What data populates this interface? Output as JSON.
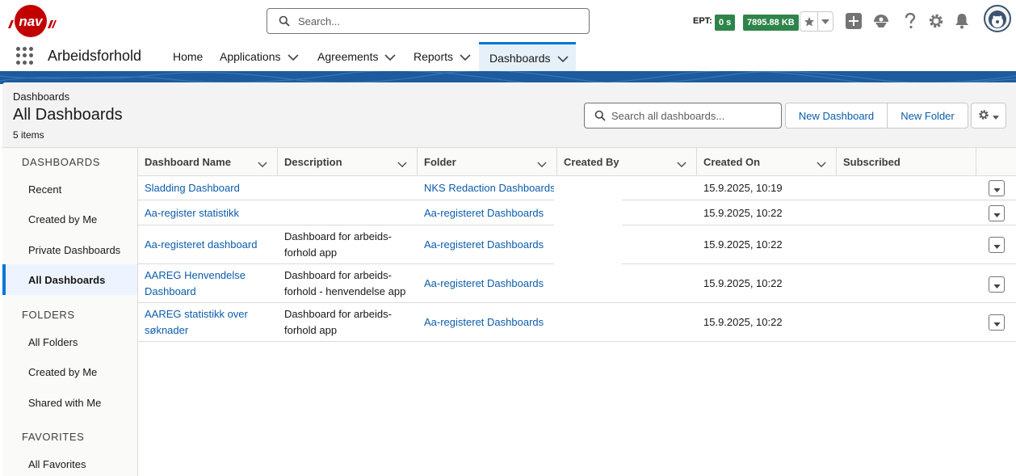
{
  "header": {
    "search_placeholder": "Search...",
    "ept_label": "EPT:",
    "ept_value": "0 s",
    "kb_value": "7895.88 KB",
    "icons": [
      "star-icon",
      "add-icon",
      "trailhead-icon",
      "help-icon",
      "gear-icon",
      "bell-icon",
      "avatar"
    ],
    "accent": "#2e844a"
  },
  "nav": {
    "app_name": "Arbeidsforhold",
    "items": [
      {
        "label": "Home",
        "has_menu": false
      },
      {
        "label": "Applications",
        "has_menu": true
      },
      {
        "label": "Agreements",
        "has_menu": true
      },
      {
        "label": "Reports",
        "has_menu": true
      },
      {
        "label": "Dashboards",
        "has_menu": true,
        "active": true
      }
    ]
  },
  "page": {
    "breadcrumb": "Dashboards",
    "title": "All Dashboards",
    "count": "5 items",
    "search_placeholder": "Search all dashboards...",
    "new_dashboard_label": "New Dashboard",
    "new_folder_label": "New Folder"
  },
  "sidebar": {
    "dashboards_heading": "DASHBOARDS",
    "dashboards_items": [
      "Recent",
      "Created by Me",
      "Private Dashboards",
      "All Dashboards"
    ],
    "active_item": "All Dashboards",
    "folders_heading": "FOLDERS",
    "folders_items": [
      "All Folders",
      "Created by Me",
      "Shared with Me"
    ],
    "favorites_heading": "FAVORITES",
    "favorites_items": [
      "All Favorites"
    ]
  },
  "table": {
    "columns": [
      "Dashboard Name",
      "Description",
      "Folder",
      "Created By",
      "Created On",
      "Subscribed"
    ],
    "rows": [
      {
        "name": "Sladding Dashboard",
        "description": "",
        "folder": "NKS Redaction Dashboards",
        "created_by": "",
        "created_on": "15.9.2025, 10:19",
        "subscribed": ""
      },
      {
        "name": "Aa-register statistikk",
        "description": "",
        "folder": "Aa-registeret Dashboards",
        "created_by": "",
        "created_on": "15.9.2025, 10:22",
        "subscribed": ""
      },
      {
        "name": "Aa-registeret dashboard",
        "description": "Dashboard for arbeids-forhold app",
        "folder": "Aa-registeret Dashboards",
        "created_by": "",
        "created_on": "15.9.2025, 10:22",
        "subscribed": ""
      },
      {
        "name": "AAREG Henvendelse Dashboard",
        "description": "Dashboard for arbeids-forhold - henvendelse app",
        "folder": "Aa-registeret Dashboards",
        "created_by": "",
        "created_on": "15.9.2025, 10:22",
        "subscribed": ""
      },
      {
        "name": "AAREG statistikk over søknader",
        "description": "Dashboard for arbeids-forhold app",
        "folder": "Aa-registeret Dashboards",
        "created_by": "",
        "created_on": "15.9.2025, 10:22",
        "subscribed": ""
      }
    ]
  }
}
